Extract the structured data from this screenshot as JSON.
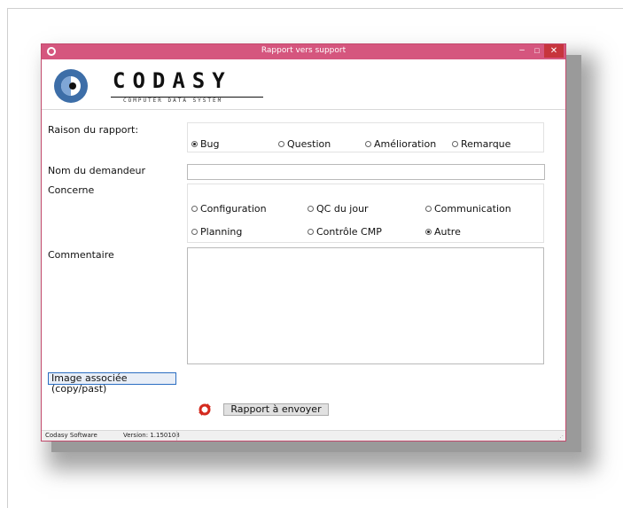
{
  "window": {
    "title": "Rapport vers support",
    "min_glyph": "–",
    "max_glyph": "□",
    "close_glyph": "✕",
    "titlebar_color": "#d5567e",
    "close_color": "#c7353c"
  },
  "logo": {
    "wordmark": "CODASY",
    "tagline": "COMPUTER DATA SYSTEM",
    "icon": "codasy-logo-icon"
  },
  "form": {
    "raison_label": "Raison du rapport:",
    "raison_options": [
      {
        "label": "Bug",
        "selected": true
      },
      {
        "label": "Question",
        "selected": false
      },
      {
        "label": "Amélioration",
        "selected": false
      },
      {
        "label": "Remarque",
        "selected": false
      }
    ],
    "demandeur_label": "Nom du demandeur",
    "demandeur_value": "",
    "concerne_label": "Concerne",
    "concerne_options": [
      {
        "label": "Configuration",
        "selected": false
      },
      {
        "label": "QC du jour",
        "selected": false
      },
      {
        "label": "Communication",
        "selected": false
      },
      {
        "label": "Planning",
        "selected": false
      },
      {
        "label": "Contrôle CMP",
        "selected": false
      },
      {
        "label": "Autre",
        "selected": true
      }
    ],
    "commentaire_label": "Commentaire",
    "commentaire_value": "",
    "image_button": "Image associée (copy/past)",
    "send_button": "Rapport à envoyer",
    "refresh_icon": "refresh-icon"
  },
  "statusbar": {
    "company": "Codasy Software",
    "version": "Version: 1.150108"
  }
}
